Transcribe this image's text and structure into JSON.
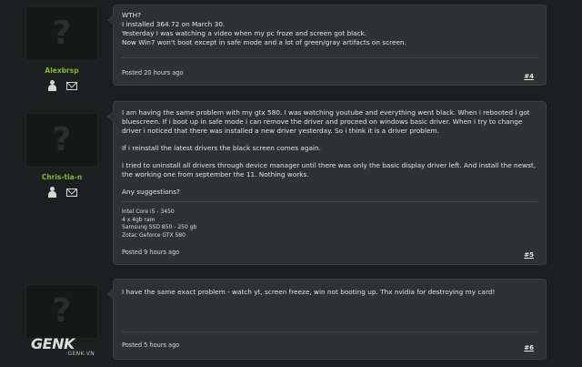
{
  "posts": [
    {
      "username": "Alexbrsp",
      "lines": [
        "WTH?",
        "I installed 364.72 on March 30.",
        "Yesterday I was watching a video when my pc froze and screen got black.",
        "Now Win7 won't boot except in safe mode and a lot of green/gray artifacts on screen."
      ],
      "posted": "Posted 20 hours ago",
      "number": "#4"
    },
    {
      "username": "Chris-tia-n",
      "paragraphs": [
        "I am having the same problem with my gtx 580. I was watching youtube and everything went black. When i rebooted i got bluescreen. If i boot up in safe mode i can remove the driver and proceed on windows basic driver. When i try to change driver i noticed that there was installed a new driver yesterday. So i think it is a driver problem.",
        "If i reinstall the latest drivers the black screen comes again.",
        "i tried to uninstall all drivers through device manager until there was only the basic display driver left. And install the newst, the working one from september the 11. Nothing works.",
        "Any suggestions?"
      ],
      "signature": [
        "Intel Core i5 - 3450",
        "4 x 4gb ram",
        "Samsung SSD 850 - 250 gb",
        "Zotac Geforce GTX 580"
      ],
      "posted": "Posted 9 hours ago",
      "number": "#5"
    },
    {
      "username": "",
      "text": "I have the same exact problem - watch yt, screen freeze, win not booting up. Thx nvidia for destroying my card!",
      "posted": "Posted 5 hours ago",
      "number": "#6"
    }
  ],
  "watermark": {
    "logo": "GENK",
    "domain": "GENK.VN"
  },
  "icons": {
    "avatar": "question-mark-avatar",
    "profile": "user-icon",
    "message": "mail-icon"
  }
}
